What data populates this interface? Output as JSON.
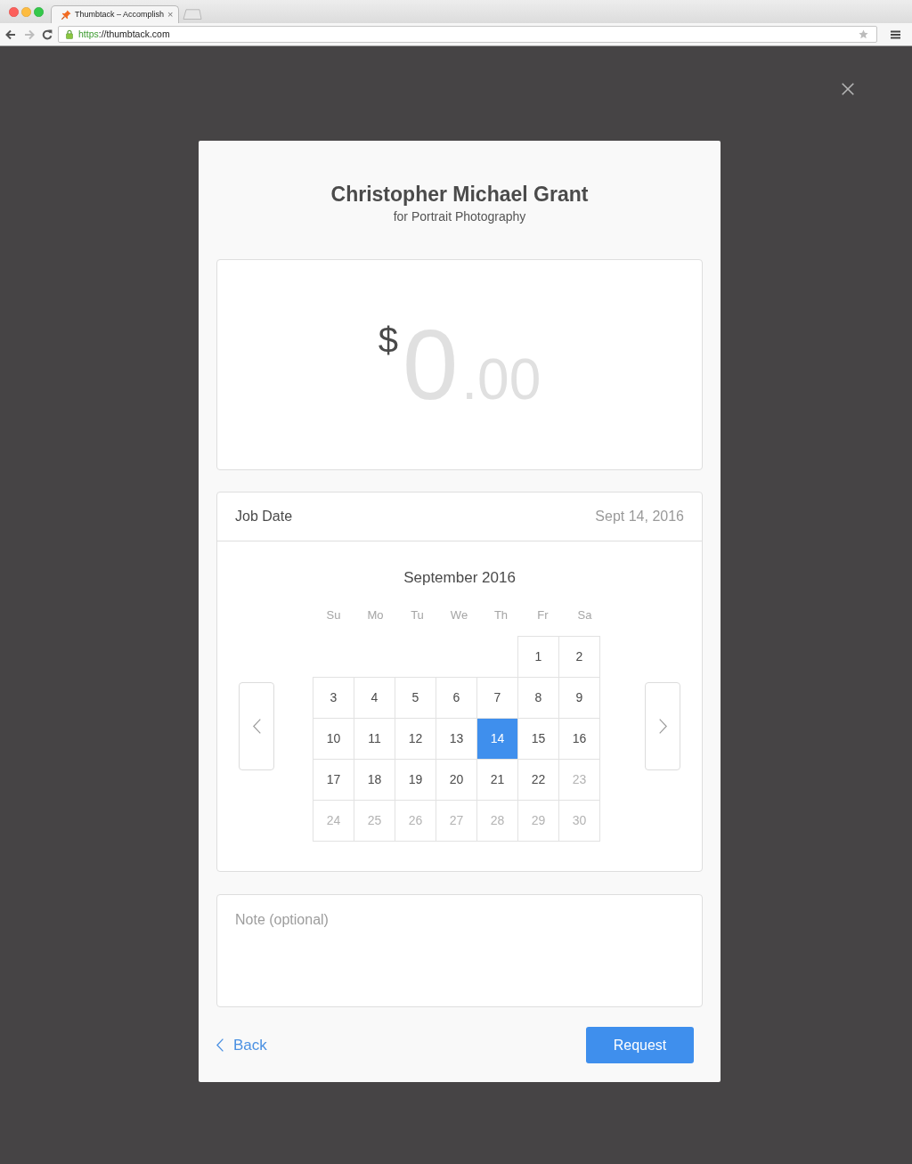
{
  "browser": {
    "tab": {
      "title": "Thumbtack – Accomplish",
      "close": "×"
    },
    "nav": [
      {
        "kind": "back",
        "disabled": false
      },
      {
        "kind": "forward",
        "disabled": true
      },
      {
        "kind": "reload",
        "disabled": false
      }
    ],
    "url": {
      "scheme": "https",
      "rest": "://thumbtack.com"
    }
  },
  "modal": {
    "title": "Christopher Michael Grant",
    "subtitle": "for Portrait Photography",
    "price": {
      "currency": "$",
      "whole": "0",
      "cents": ".00"
    },
    "job_date": {
      "label": "Job Date",
      "value": "Sept 14, 2016"
    },
    "calendar": {
      "month": "September 2016",
      "weekdays": [
        "Su",
        "Mo",
        "Tu",
        "We",
        "Th",
        "Fr",
        "Sa"
      ],
      "weeks": [
        [
          {
            "day": "1",
            "selected": false,
            "disabled": false
          },
          {
            "day": "2",
            "selected": false,
            "disabled": false
          }
        ],
        [
          {
            "day": "3",
            "selected": false,
            "disabled": false
          },
          {
            "day": "4",
            "selected": false,
            "disabled": false
          },
          {
            "day": "5",
            "selected": false,
            "disabled": false
          },
          {
            "day": "6",
            "selected": false,
            "disabled": false
          },
          {
            "day": "7",
            "selected": false,
            "disabled": false
          },
          {
            "day": "8",
            "selected": false,
            "disabled": false
          },
          {
            "day": "9",
            "selected": false,
            "disabled": false
          }
        ],
        [
          {
            "day": "10",
            "selected": false,
            "disabled": false
          },
          {
            "day": "11",
            "selected": false,
            "disabled": false
          },
          {
            "day": "12",
            "selected": false,
            "disabled": false
          },
          {
            "day": "13",
            "selected": false,
            "disabled": false
          },
          {
            "day": "14",
            "selected": true,
            "disabled": false
          },
          {
            "day": "15",
            "selected": false,
            "disabled": false
          },
          {
            "day": "16",
            "selected": false,
            "disabled": false
          }
        ],
        [
          {
            "day": "17",
            "selected": false,
            "disabled": false
          },
          {
            "day": "18",
            "selected": false,
            "disabled": false
          },
          {
            "day": "19",
            "selected": false,
            "disabled": false
          },
          {
            "day": "20",
            "selected": false,
            "disabled": false
          },
          {
            "day": "21",
            "selected": false,
            "disabled": false
          },
          {
            "day": "22",
            "selected": false,
            "disabled": false
          },
          {
            "day": "23",
            "selected": false,
            "disabled": true
          }
        ],
        [
          {
            "day": "24",
            "selected": false,
            "disabled": true
          },
          {
            "day": "25",
            "selected": false,
            "disabled": true
          },
          {
            "day": "26",
            "selected": false,
            "disabled": true
          },
          {
            "day": "27",
            "selected": false,
            "disabled": true
          },
          {
            "day": "28",
            "selected": false,
            "disabled": true
          },
          {
            "day": "29",
            "selected": false,
            "disabled": true
          },
          {
            "day": "30",
            "selected": false,
            "disabled": true
          }
        ]
      ]
    },
    "note": {
      "placeholder": "Note (optional)"
    },
    "back": {
      "label": "Back"
    },
    "request": {
      "label": "Request"
    }
  }
}
